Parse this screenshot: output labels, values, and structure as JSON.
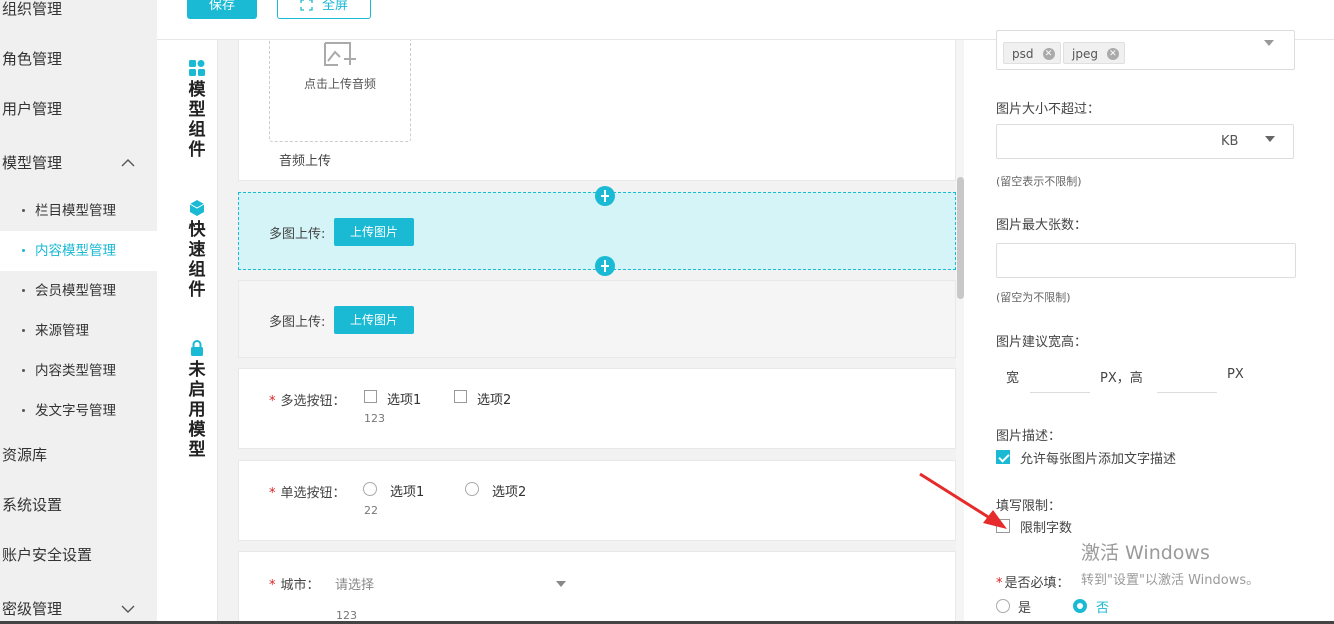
{
  "sidebar": {
    "items": [
      {
        "label": "组织管理"
      },
      {
        "label": "角色管理"
      },
      {
        "label": "用户管理"
      },
      {
        "label": "模型管理"
      },
      {
        "label": "资源库"
      },
      {
        "label": "系统设置"
      },
      {
        "label": "账户安全设置"
      },
      {
        "label": "密级管理"
      }
    ],
    "model_sub": [
      {
        "label": "栏目模型管理"
      },
      {
        "label": "内容模型管理",
        "active": true
      },
      {
        "label": "会员模型管理"
      },
      {
        "label": "来源管理"
      },
      {
        "label": "内容类型管理"
      },
      {
        "label": "发文字号管理"
      }
    ]
  },
  "toolbar": {
    "save_label": "保存",
    "fullscreen_label": "全屏"
  },
  "rail": {
    "groups": [
      {
        "label": "模型组件",
        "icon": "grid-icon"
      },
      {
        "label": "快速组件",
        "icon": "cube-icon"
      },
      {
        "label": "未启用模型",
        "icon": "lock-icon"
      }
    ]
  },
  "canvas": {
    "audio_upload_text": "点击上传音频",
    "audio_label": "音频上传",
    "multi_image_label": "多图上传:",
    "upload_image_btn": "上传图片",
    "checkbox_field": {
      "label": "多选按钮：",
      "options": [
        "选项1",
        "选项2"
      ],
      "value": "123"
    },
    "radio_field": {
      "label": "单选按钮：",
      "options": [
        "选项1",
        "选项2"
      ],
      "value": "22"
    },
    "city_field": {
      "label": "城市：",
      "placeholder": "请选择",
      "value": "123"
    }
  },
  "panel": {
    "tags": [
      "psd",
      "jpeg"
    ],
    "size_label": "图片大小不超过：",
    "size_unit": "KB",
    "size_hint": "(留空表示不限制)",
    "max_count_label": "图片最大张数：",
    "max_count_hint": "(留空为不限制)",
    "wh_label": "图片建议宽高：",
    "w_prefix": "宽",
    "px_h": "PX，高",
    "px": "PX",
    "desc_label": "图片描述：",
    "desc_check": "允许每张图片添加文字描述",
    "limit_label": "填写限制：",
    "limit_check": "限制字数",
    "required_label": "是否必填：",
    "yes": "是",
    "no": "否"
  },
  "watermark": {
    "line1": "激活 Windows",
    "line2": "转到\"设置\"以激活 Windows。"
  },
  "colors": {
    "accent": "#1ab9d4",
    "required": "#e02020",
    "annotation_arrow": "#e52b2b"
  }
}
